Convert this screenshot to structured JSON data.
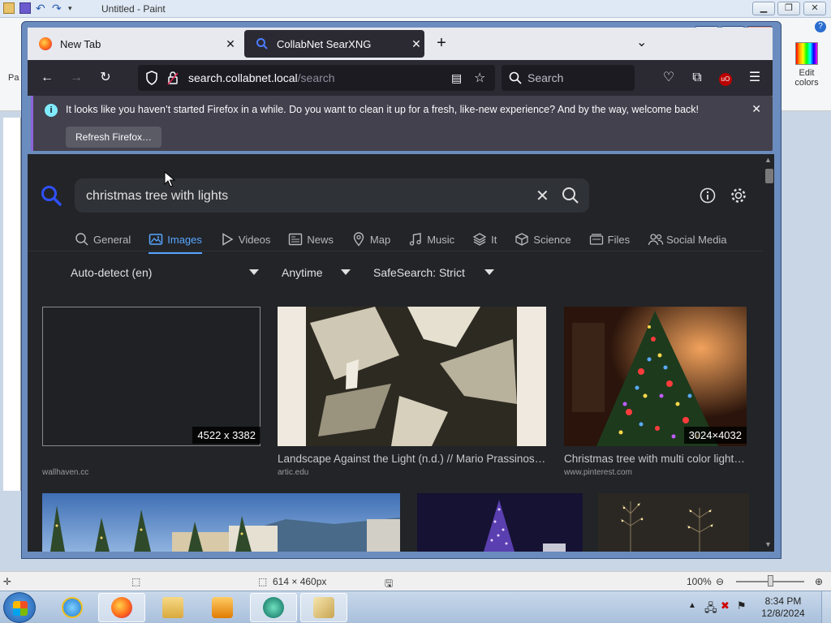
{
  "paint": {
    "window_title": "Untitled - Paint",
    "ribbon_label_partial": "Pa",
    "edit_colors_label": "Edit colors",
    "status_dimensions": "614 × 460px",
    "zoom_level": "100%"
  },
  "taskbar": {
    "time": "8:34 PM",
    "date": "12/8/2024"
  },
  "firefox": {
    "tabs": [
      {
        "label": "New Tab",
        "active": false
      },
      {
        "label": "CollabNet SearXNG",
        "active": true
      }
    ],
    "url_host": "search.collabnet.local",
    "url_path": "/search",
    "search_placeholder": "Search",
    "notification": {
      "message": "It looks like you haven’t started Firefox in a while. Do you want to clean it up for a fresh, like-new experience? And by the way, welcome back!",
      "button": "Refresh Firefox…"
    }
  },
  "searxng": {
    "query": "christmas tree with lights",
    "categories": [
      {
        "label": "General",
        "icon": "search-icon",
        "active": false
      },
      {
        "label": "Images",
        "icon": "image-icon",
        "active": true
      },
      {
        "label": "Videos",
        "icon": "play-icon",
        "active": false
      },
      {
        "label": "News",
        "icon": "newspaper-icon",
        "active": false
      },
      {
        "label": "Map",
        "icon": "map-pin-icon",
        "active": false
      },
      {
        "label": "Music",
        "icon": "music-icon",
        "active": false
      },
      {
        "label": "It",
        "icon": "layers-icon",
        "active": false
      },
      {
        "label": "Science",
        "icon": "cube-icon",
        "active": false
      },
      {
        "label": "Files",
        "icon": "files-icon",
        "active": false
      },
      {
        "label": "Social Media",
        "icon": "people-icon",
        "active": false
      }
    ],
    "filters": {
      "language": "Auto-detect (en)",
      "time_range": "Anytime",
      "safesearch": "SafeSearch: Strict"
    },
    "results": [
      {
        "title": "",
        "source": "wallhaven.cc",
        "dimensions": "4522 x 3382"
      },
      {
        "title": "Landscape Against the Light (n.d.) // Mario Prassinos ...",
        "source": "artic.edu",
        "dimensions": ""
      },
      {
        "title": "Christmas tree with multi color lights ...",
        "source": "www.pinterest.com",
        "dimensions": "3024×4032"
      }
    ]
  }
}
